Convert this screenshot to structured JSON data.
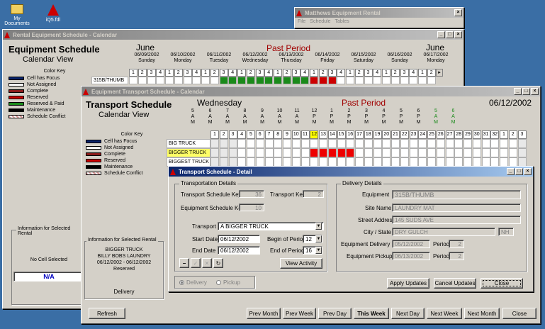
{
  "desktop": {
    "icons": [
      {
        "label": "My Documents"
      },
      {
        "label": "iQ5.fdl"
      }
    ]
  },
  "matthews_window": {
    "title": "Matthews Equipment Rental",
    "menu": [
      "File",
      "Schedule",
      "Tables"
    ]
  },
  "rental_window": {
    "title": "Rental Equipment Schedule - Calendar",
    "heading": "Equipment Schedule",
    "subheading": "Calendar View",
    "month_left": "June",
    "month_right": "June",
    "past_period": "Past Period",
    "days": [
      {
        "date": "06/09/2002",
        "dow": "Sunday"
      },
      {
        "date": "06/10/2002",
        "dow": "Monday"
      },
      {
        "date": "06/11/2002",
        "dow": "Tuesday"
      },
      {
        "date": "06/12/2002",
        "dow": "Wednesday"
      },
      {
        "date": "06/13/2002",
        "dow": "Thursday"
      },
      {
        "date": "06/14/2002",
        "dow": "Friday"
      },
      {
        "date": "06/15/2002",
        "dow": "Saturday"
      },
      {
        "date": "06/16/2002",
        "dow": "Sunday"
      },
      {
        "date": "06/17/2002",
        "dow": "Monday"
      }
    ],
    "period_nums": [
      "1",
      "2",
      "3",
      "4"
    ],
    "row_label": "315B/THUMB",
    "color_key_title": "Color Key",
    "color_key": [
      {
        "label": "Cell has Focus",
        "color": "#0a246a"
      },
      {
        "label": "Not Assigned",
        "color": "#ffffff"
      },
      {
        "label": "Complete",
        "color": "#8b1a1a"
      },
      {
        "label": "Reserved",
        "color": "#cc0000"
      },
      {
        "label": "Reserved & Paid",
        "color": "#1a8a1a"
      },
      {
        "label": "Maintenance",
        "color": "#000000"
      },
      {
        "label": "Schedule Conflict",
        "color": "#e0a0a0"
      }
    ],
    "info_title": "Information for Selected Rental",
    "no_cell": "No Cell Selected",
    "na": "N/A"
  },
  "transport_window": {
    "title": "Equipment Transport Schedule - Calendar",
    "heading": "Transport Schedule",
    "subheading": "Calendar View",
    "day_name": "Wednesday",
    "past_period": "Past Period",
    "date": "06/12/2002",
    "hours": [
      {
        "h": "5",
        "ap": "A",
        "m": "M"
      },
      {
        "h": "6",
        "ap": "A",
        "m": "M"
      },
      {
        "h": "7",
        "ap": "A",
        "m": "M"
      },
      {
        "h": "8",
        "ap": "A",
        "m": "M"
      },
      {
        "h": "9",
        "ap": "A",
        "m": "M"
      },
      {
        "h": "10",
        "ap": "A",
        "m": "M"
      },
      {
        "h": "11",
        "ap": "A",
        "m": "M"
      },
      {
        "h": "12",
        "ap": "P",
        "m": "M"
      },
      {
        "h": "1",
        "ap": "P",
        "m": "M"
      },
      {
        "h": "2",
        "ap": "P",
        "m": "M"
      },
      {
        "h": "3",
        "ap": "P",
        "m": "M"
      },
      {
        "h": "4",
        "ap": "P",
        "m": "M"
      },
      {
        "h": "5",
        "ap": "P",
        "m": "M"
      },
      {
        "h": "6",
        "ap": "P",
        "m": "M"
      },
      {
        "h": "5",
        "ap": "A",
        "m": "M"
      },
      {
        "h": "6",
        "ap": "A",
        "m": "M"
      }
    ],
    "period_nums": [
      "1",
      "2",
      "3",
      "4",
      "5",
      "6",
      "7",
      "8",
      "9",
      "10",
      "11",
      "12",
      "13",
      "14",
      "15",
      "16",
      "17",
      "18",
      "19",
      "20",
      "21",
      "22",
      "23",
      "24",
      "25",
      "26",
      "27",
      "28",
      "29",
      "30",
      "31",
      "32",
      "1",
      "2",
      "3"
    ],
    "trucks": [
      "BIG TRUCK",
      "BIGGER TRUCK",
      "BIGGEST TRUCK"
    ],
    "color_key_title": "Color Key",
    "color_key": [
      {
        "label": "Cell has Focus",
        "color": "#0a246a"
      },
      {
        "label": "Not Assigned",
        "color": "#ffffff"
      },
      {
        "label": "Complete",
        "color": "#8b1a1a"
      },
      {
        "label": "Reserved",
        "color": "#cc0000"
      },
      {
        "label": "Maintenance",
        "color": "#000000"
      },
      {
        "label": "Schedule Conflict",
        "color": "#e0a0a0"
      }
    ],
    "info_title": "Information for Selected Rental",
    "info_lines": [
      "BIGGER TRUCK",
      "BILLY BOBS LAUNDRY",
      "06/12/2002 - 06/12/2002",
      "Reserved"
    ],
    "info_type": "Delivery",
    "buttons": [
      "Refresh",
      "Prev Month",
      "Prev Week",
      "Prev Day",
      "This Week",
      "Next Day",
      "Next Week",
      "Next Month",
      "Close"
    ]
  },
  "detail_window": {
    "title": "Transport Schedule - Detail",
    "transport_details_title": "Transportation Details",
    "transport_schedule_key_label": "Transport Schedule Key",
    "transport_schedule_key": "36",
    "transport_key_label": "Transport Key",
    "transport_key": "2",
    "equipment_schedule_key_label": "Equipment Schedule Key",
    "equipment_schedule_key": "10",
    "transport_label": "Transport",
    "transport_value": "A BIGGER TRUCK",
    "start_date_label": "Start Date",
    "start_date": "06/12/2002",
    "end_date_label": "End Date",
    "end_date": "06/12/2002",
    "begin_period_label": "Begin of Period",
    "begin_period": "12",
    "end_period_label": "End of Period",
    "end_period": "16",
    "view_activity": "View Activity",
    "radio_delivery": "Delivery",
    "radio_pickup": "Pickup",
    "delivery_details_title": "Delivery Details",
    "equipment_label": "Equipment",
    "equipment": "315B/THUMB",
    "site_label": "Site Name",
    "site": "LAUNDRY MAT",
    "street_label": "Street Address",
    "street": "145 SUDS AVE",
    "city_label": "City / State",
    "city": "DRY GULCH",
    "state": "NH",
    "eq_delivery_label": "Equipment Delivery",
    "eq_delivery": "05/12/2002",
    "eq_delivery_period": "2",
    "eq_pickup_label": "Equipment Pickup",
    "eq_pickup": "06/13/2002",
    "eq_pickup_period": "2",
    "period_label": "Period",
    "apply": "Apply Updates",
    "cancel": "Cancel Updates",
    "close": "Close"
  }
}
